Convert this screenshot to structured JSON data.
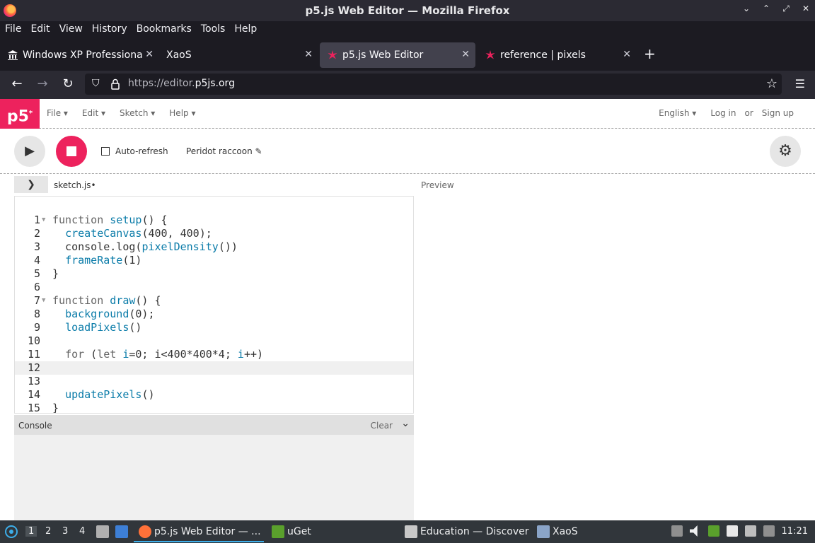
{
  "window": {
    "title": "p5.js Web Editor — Mozilla Firefox",
    "controls": [
      "⌄",
      "⌃",
      "⤢",
      "✕"
    ]
  },
  "menubar": [
    "File",
    "Edit",
    "View",
    "History",
    "Bookmarks",
    "Tools",
    "Help"
  ],
  "tabs": [
    {
      "title": "Windows XP Professional",
      "active": false
    },
    {
      "title": "XaoS",
      "active": false
    },
    {
      "title": "p5.js Web Editor",
      "active": true
    },
    {
      "title": "reference | pixels",
      "active": false
    }
  ],
  "url": {
    "prefix": "https://editor.",
    "domain": "p5js.org"
  },
  "p5": {
    "logo": "p5",
    "menu": [
      "File ▾",
      "Edit ▾",
      "Sketch ▾",
      "Help ▾"
    ],
    "language": "English ▾",
    "login": "Log in",
    "or": "or",
    "signup": "Sign up",
    "autorefresh": "Auto-refresh",
    "sketch_name": "Peridot raccoon ✎",
    "file_tab": "sketch.js•",
    "preview": "Preview",
    "console": "Console",
    "clear": "Clear"
  },
  "code": [
    {
      "n": "1",
      "fold": true,
      "text": "function setup() {"
    },
    {
      "n": "2",
      "fold": false,
      "text": "  createCanvas(400, 400);"
    },
    {
      "n": "3",
      "fold": false,
      "text": "  console.log(pixelDensity())"
    },
    {
      "n": "4",
      "fold": false,
      "text": "  frameRate(1)"
    },
    {
      "n": "5",
      "fold": false,
      "text": "}"
    },
    {
      "n": "6",
      "fold": false,
      "text": ""
    },
    {
      "n": "7",
      "fold": true,
      "text": "function draw() {"
    },
    {
      "n": "8",
      "fold": false,
      "text": "  background(0);"
    },
    {
      "n": "9",
      "fold": false,
      "text": "  loadPixels()"
    },
    {
      "n": "10",
      "fold": false,
      "text": ""
    },
    {
      "n": "11",
      "fold": false,
      "text": "  for (let i=0; i<400*400*4; i++)"
    },
    {
      "n": "12",
      "fold": false,
      "text": "",
      "current": true
    },
    {
      "n": "13",
      "fold": false,
      "text": ""
    },
    {
      "n": "14",
      "fold": false,
      "text": "  updatePixels()"
    },
    {
      "n": "15",
      "fold": false,
      "text": "}"
    }
  ],
  "taskbar": {
    "desktops": [
      "1",
      "2",
      "3",
      "4"
    ],
    "apps": [
      {
        "label": "p5.js Web Editor — ...",
        "color": "#ff7139"
      },
      {
        "label": "uGet",
        "color": "#5aa02c"
      },
      {
        "label": "Education — Discover",
        "color": "#c8c8c8"
      },
      {
        "label": "XaoS",
        "color": "#8aa4c8"
      }
    ],
    "clock": "11:21"
  }
}
